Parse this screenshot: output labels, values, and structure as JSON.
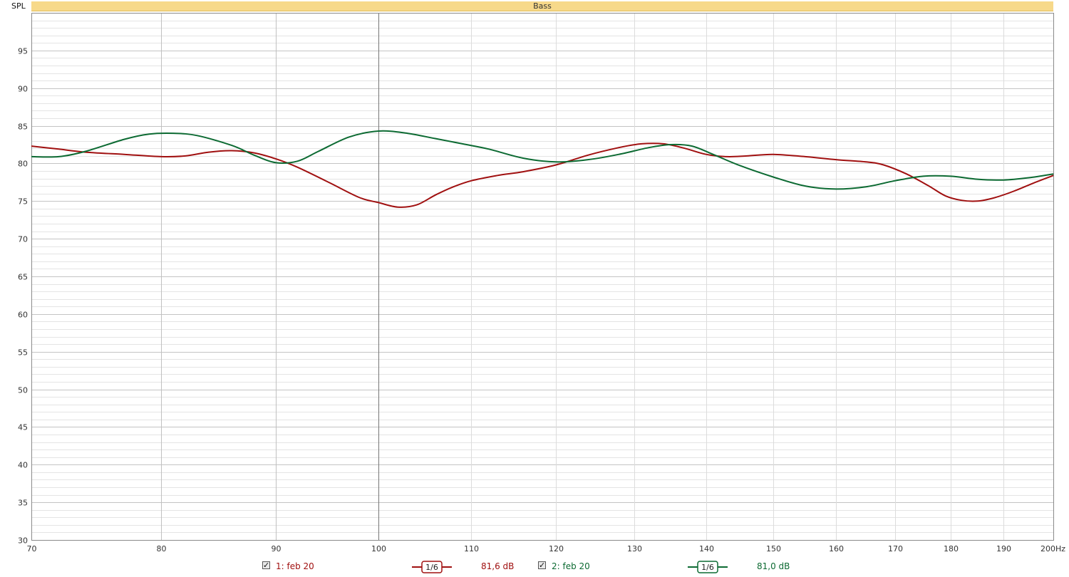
{
  "chart_data": {
    "type": "line",
    "title": "Bass",
    "ylabel": "SPL",
    "xunit": "Hz",
    "xscale": "log",
    "xlim": [
      70,
      200
    ],
    "ylim": [
      30,
      100
    ],
    "xticks": [
      70,
      80,
      90,
      100,
      110,
      120,
      130,
      140,
      150,
      160,
      170,
      180,
      190,
      200
    ],
    "xtick_labels": [
      "70",
      "80",
      "90",
      "100",
      "110",
      "120",
      "130",
      "140",
      "150",
      "160",
      "170",
      "180",
      "190",
      "200Hz"
    ],
    "yticks": [
      30,
      35,
      40,
      45,
      50,
      55,
      60,
      65,
      70,
      75,
      80,
      85,
      90,
      95
    ],
    "grid": true,
    "legend_position": "bottom",
    "series": [
      {
        "name": "1: feb 20",
        "color": "#a01010",
        "smoothing": "1/6",
        "level": "81,6 dB",
        "points": [
          [
            70,
            82.3
          ],
          [
            72,
            81.9
          ],
          [
            74,
            81.5
          ],
          [
            77,
            81.2
          ],
          [
            80,
            80.9
          ],
          [
            82,
            81.0
          ],
          [
            84,
            81.5
          ],
          [
            86,
            81.7
          ],
          [
            88,
            81.4
          ],
          [
            90,
            80.6
          ],
          [
            92,
            79.5
          ],
          [
            95,
            77.5
          ],
          [
            98,
            75.5
          ],
          [
            100,
            74.8
          ],
          [
            102,
            74.2
          ],
          [
            104,
            74.5
          ],
          [
            106,
            75.8
          ],
          [
            108,
            76.9
          ],
          [
            110,
            77.7
          ],
          [
            113,
            78.4
          ],
          [
            116,
            78.9
          ],
          [
            120,
            79.8
          ],
          [
            124,
            81.1
          ],
          [
            128,
            82.1
          ],
          [
            131,
            82.6
          ],
          [
            134,
            82.6
          ],
          [
            137,
            82.0
          ],
          [
            140,
            81.2
          ],
          [
            143,
            80.9
          ],
          [
            146,
            81.0
          ],
          [
            150,
            81.2
          ],
          [
            155,
            80.9
          ],
          [
            160,
            80.5
          ],
          [
            165,
            80.2
          ],
          [
            168,
            79.8
          ],
          [
            172,
            78.6
          ],
          [
            176,
            77.0
          ],
          [
            179,
            75.7
          ],
          [
            182,
            75.1
          ],
          [
            185,
            75.0
          ],
          [
            188,
            75.4
          ],
          [
            192,
            76.3
          ],
          [
            196,
            77.4
          ],
          [
            200,
            78.4
          ]
        ]
      },
      {
        "name": "2: feb 20",
        "color": "#0c6a32",
        "smoothing": "1/6",
        "level": "81,0 dB",
        "points": [
          [
            70,
            80.9
          ],
          [
            72,
            80.9
          ],
          [
            74,
            81.6
          ],
          [
            77,
            83.2
          ],
          [
            79,
            83.9
          ],
          [
            81,
            84.0
          ],
          [
            83,
            83.7
          ],
          [
            86,
            82.4
          ],
          [
            88,
            81.1
          ],
          [
            90,
            80.1
          ],
          [
            92,
            80.3
          ],
          [
            94,
            81.6
          ],
          [
            97,
            83.5
          ],
          [
            100,
            84.3
          ],
          [
            103,
            84.0
          ],
          [
            106,
            83.3
          ],
          [
            109,
            82.6
          ],
          [
            112,
            81.9
          ],
          [
            116,
            80.7
          ],
          [
            120,
            80.2
          ],
          [
            124,
            80.5
          ],
          [
            128,
            81.2
          ],
          [
            132,
            82.1
          ],
          [
            135,
            82.5
          ],
          [
            138,
            82.3
          ],
          [
            141,
            81.2
          ],
          [
            145,
            79.7
          ],
          [
            150,
            78.2
          ],
          [
            155,
            77.0
          ],
          [
            160,
            76.6
          ],
          [
            165,
            76.9
          ],
          [
            170,
            77.7
          ],
          [
            175,
            78.3
          ],
          [
            180,
            78.3
          ],
          [
            185,
            77.9
          ],
          [
            190,
            77.8
          ],
          [
            195,
            78.1
          ],
          [
            200,
            78.6
          ]
        ]
      }
    ]
  },
  "legend": {
    "item1": {
      "label": "1: feb 20",
      "smoothing": "1/6",
      "level": "81,6 dB",
      "checked": true
    },
    "item2": {
      "label": "2: feb 20",
      "smoothing": "1/6",
      "level": "81,0 dB",
      "checked": true
    },
    "check_glyph": "✓"
  }
}
